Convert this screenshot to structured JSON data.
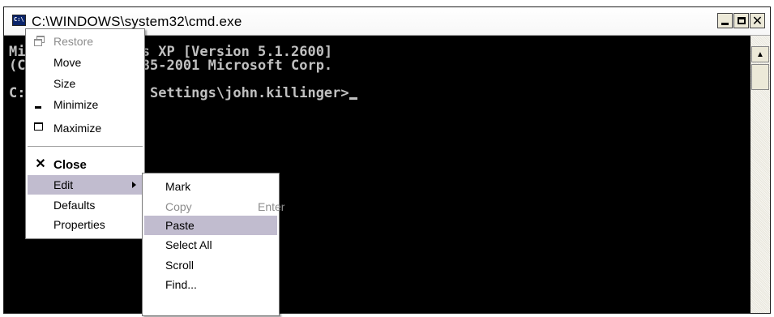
{
  "window": {
    "title": "C:\\WINDOWS\\system32\\cmd.exe",
    "minimize_label": "minimize",
    "maximize_label": "maximize",
    "close_label": "close"
  },
  "console": {
    "lines": [
      "Microsoft Windows XP [Version 5.1.2600]",
      "(C) Copyright 1985-2001 Microsoft Corp.",
      "",
      "C:\\Documents and Settings\\john.killinger>"
    ]
  },
  "system_menu": {
    "items": [
      {
        "label": "Restore",
        "icon": "restore-icon",
        "disabled": true
      },
      {
        "label": "Move",
        "disabled": false
      },
      {
        "label": "Size",
        "disabled": false
      },
      {
        "label": "Minimize",
        "icon": "minimize-icon",
        "disabled": false
      },
      {
        "label": "Maximize",
        "icon": "maximize-icon",
        "disabled": false
      },
      {
        "label": "Close",
        "icon": "close-icon",
        "bold": true
      },
      {
        "label": "Edit",
        "submenu": true,
        "highlighted": true
      },
      {
        "label": "Defaults"
      },
      {
        "label": "Properties"
      }
    ]
  },
  "edit_menu": {
    "items": [
      {
        "label": "Mark"
      },
      {
        "label": "Copy",
        "accelerator": "Enter",
        "disabled": true
      },
      {
        "label": "Paste",
        "highlighted": true
      },
      {
        "label": "Select All"
      },
      {
        "label": "Scroll"
      },
      {
        "label": "Find..."
      }
    ]
  },
  "colors": {
    "console_bg": "#000000",
    "console_text": "#c0c0c0",
    "menu_highlight": "#c1bccf",
    "disabled_text": "#8d8d8d"
  }
}
